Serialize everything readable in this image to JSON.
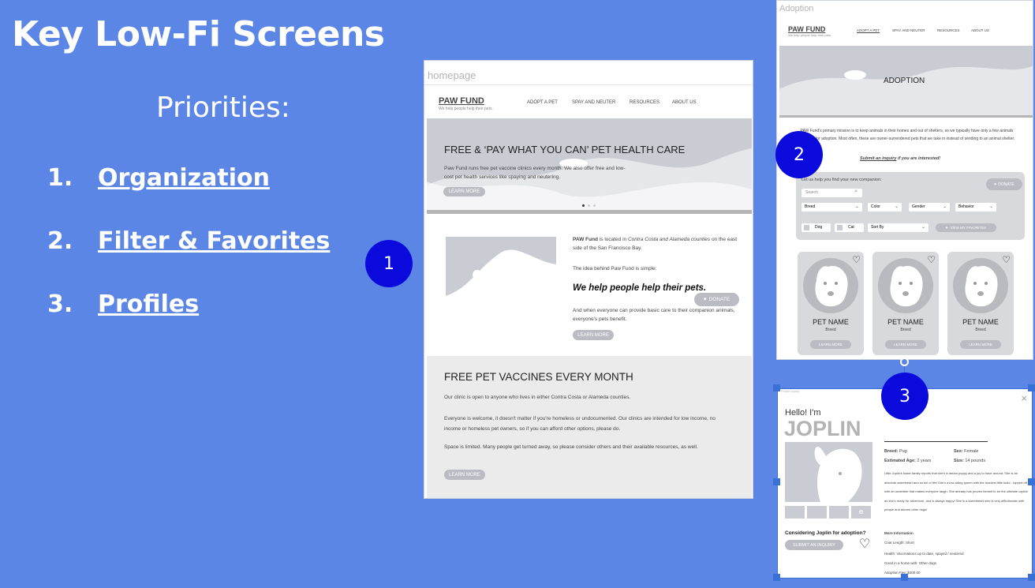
{
  "slide": {
    "title": "Key Low-Fi Screens",
    "priorities_heading": "Priorities:",
    "priorities": [
      {
        "num": "1.",
        "label": "Organization"
      },
      {
        "num": "2.",
        "label": "Filter & Favorites"
      },
      {
        "num": "3.",
        "label": "Profiles"
      }
    ],
    "badges": [
      "1",
      "2",
      "3"
    ]
  },
  "homepage": {
    "frame_label": "homepage",
    "logo": "PAW FUND",
    "tagline": "We help people help their pets.",
    "nav": [
      "ADOPT A PET",
      "SPAY AND NEUTER",
      "RESOURCES",
      "ABOUT US"
    ],
    "hero_title": "FREE & ‘PAY WHAT YOU CAN’ PET HEALTH CARE",
    "hero_text": "Paw Fund runs free pet vaccine clinics every month. We also offer free and low-cost pet health services like spaying and neutering.",
    "hero_button": "LEARN MORE",
    "about_p1_bold": "PAW Fund",
    "about_p1": " is located in ",
    "about_p1_italic": "Contra Costa and Alameda counties",
    "about_p1_end": " on the east side of the San Francisco Bay.",
    "about_p2": "The idea behind Paw Fund is simple:",
    "about_slogan": "We help people help their pets.",
    "about_p3": "And when everyone can provide basic care to their companion animals, everyone's pets benefit.",
    "about_button": "LEARN MORE",
    "donate": "DONATE",
    "vaccines_title": "FREE PET VACCINES EVERY MONTH",
    "vaccines_p1": "Our clinic is open to anyone who lives in either Contra Costa or Alameda counties.",
    "vaccines_p2": "Everyone is welcome, it doesn't matter if you're homeless or undocumented. Our clinics are intended for low income, no income or homeless pet owners, so if you can afford other options, please do.",
    "vaccines_p3": "Space is limited. Many people get turned away, so please consider others and their available resources, as well.",
    "vaccines_button": "LEARN MORE"
  },
  "adoption": {
    "frame_label": "Adoption",
    "logo": "PAW FUND",
    "tagline": "We help people help their pets.",
    "nav": [
      "ADOPT A PET",
      "SPAY AND NEUTER",
      "RESOURCES",
      "ABOUT US"
    ],
    "hero_title": "ADOPTION",
    "intro": "PAW Fund's primary mission is to keep animals in their homes and out of shelters, so we typically have only a few animals available for adoption. Most often, these are owner-surrendered pets that we take in instead of sending to an animal shelter.",
    "inquiry_link": "Submit an inquiry",
    "inquiry_rest": " if you are interested!",
    "filter_heading": "Let us help you find your new companion:",
    "donate": "DONATE",
    "search_placeholder": "Search",
    "selects": [
      "Breed",
      "Color",
      "Gender",
      "Behavior"
    ],
    "check_dog": "Dog",
    "check_cat": "Cat",
    "sort_by": "Sort By",
    "favorites_button": "VIEW MY FAVORITES",
    "pets": [
      {
        "name": "PET NAME",
        "breed": "Breed",
        "button": "LEARN MORE"
      },
      {
        "name": "PET NAME",
        "breed": "Breed",
        "button": "LEARN MORE"
      },
      {
        "name": "PET NAME",
        "breed": "Breed",
        "button": "LEARN MORE"
      }
    ]
  },
  "profile": {
    "frame_label": "Profile popup",
    "greeting": "Hello! I'm",
    "name": "JOPLIN",
    "breed_label": "Breed:",
    "breed": "Pug",
    "sex_label": "Sex:",
    "sex": "Female",
    "age_label": "Estimated Age:",
    "age": "2 years",
    "size_label": "Size:",
    "size": "14 pounds",
    "description": "Little Joplin's foster family reports that she's a dream puppy and a joy to have around. She is an absolute sweetheart and so full of life! She's a low-riding queen with the funniest little build - topped off with an underbite that makes everyone laugh. She already has proven herself to be the ultimate copilot as she's ready for adventure, and is always happy! She is a sweetheart who is very affectionate with people and adores other dogs!",
    "more_info_heading": "More Information",
    "more_info": [
      "Coat Length: Short",
      "Health: Vaccinations up to date, spayed / neutered",
      "Good in a home with: Other dogs",
      "Adoption Fee: $400.00"
    ],
    "considering": "Considering Joplin for adoption?",
    "inquiry_button": "SUBMIT AN INQUIRY",
    "close": "×"
  },
  "colors": {
    "background": "#5b86e5",
    "badge": "#0a0adc",
    "wire_grey": "#c9ccd3",
    "button_grey": "#bbbbc4"
  }
}
